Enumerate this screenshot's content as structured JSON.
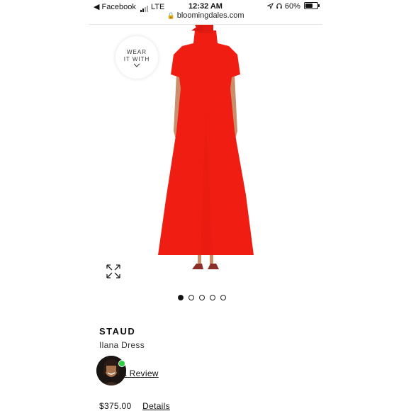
{
  "status_bar": {
    "back_app": "◀ Facebook",
    "network": "LTE",
    "time": "12:32 AM",
    "battery": "60%",
    "battery_level": 0.6
  },
  "url_bar": {
    "domain": "bloomingdales.com"
  },
  "product_image": {
    "wear_line1": "WEAR",
    "wear_line2": "IT WITH",
    "dress_color": "#f01e12",
    "carousel_count": 5,
    "carousel_active": 0
  },
  "product": {
    "brand": "STAUD",
    "name": "Ilana Dress",
    "review_link": "a Review",
    "price": "$375.00",
    "details_link": "Details"
  },
  "icons": [
    "lock-icon",
    "location-arrow-icon",
    "headphones-icon",
    "battery-icon",
    "chevron-down-icon",
    "expand-icon"
  ]
}
